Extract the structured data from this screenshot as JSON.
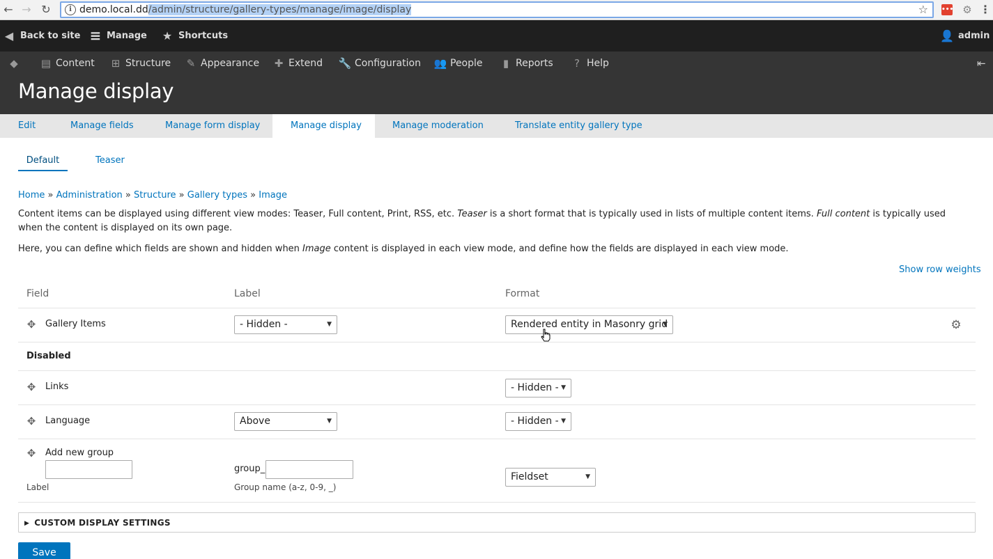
{
  "browser": {
    "url_host": "demo.local.dd",
    "url_path": "/admin/structure/gallery-types/manage/image/display",
    "ext_label": "•••"
  },
  "toolbar": {
    "back_to_site": "Back to site",
    "manage": "Manage",
    "shortcuts": "Shortcuts",
    "user": "admin"
  },
  "admin_menu": {
    "items": [
      "Content",
      "Structure",
      "Appearance",
      "Extend",
      "Configuration",
      "People",
      "Reports",
      "Help"
    ]
  },
  "page": {
    "title": "Manage display"
  },
  "primary_tabs": [
    "Edit",
    "Manage fields",
    "Manage form display",
    "Manage display",
    "Manage moderation",
    "Translate entity gallery type"
  ],
  "secondary_tabs": [
    "Default",
    "Teaser"
  ],
  "breadcrumb": [
    "Home",
    "Administration",
    "Structure",
    "Gallery types",
    "Image"
  ],
  "breadcrumb_sep": "»",
  "description": {
    "p1_a": "Content items can be displayed using different view modes: Teaser, Full content, Print, RSS, etc. ",
    "p1_em1": "Teaser",
    "p1_b": " is a short format that is typically used in lists of multiple content items. ",
    "p1_em2": "Full content",
    "p1_c": " is typically used when the content is displayed on its own page.",
    "p2_a": "Here, you can define which fields are shown and hidden when ",
    "p2_em": "Image",
    "p2_b": " content is displayed in each view mode, and define how the fields are displayed in each view mode."
  },
  "show_row_weights": "Show row weights",
  "table": {
    "headers": {
      "field": "Field",
      "label": "Label",
      "format": "Format"
    },
    "rows": [
      {
        "field": "Gallery Items",
        "label": "- Hidden -",
        "format": "Rendered entity in Masonry grid"
      },
      {
        "field": "Links",
        "label": "",
        "format": "- Hidden -"
      },
      {
        "field": "Language",
        "label": "Above",
        "format": "- Hidden -"
      }
    ],
    "disabled_label": "Disabled",
    "add_group": {
      "title": "Add new group",
      "label_caption": "Label",
      "prefix": "group_",
      "name_caption": "Group name (a-z, 0-9, _)",
      "format": "Fieldset"
    }
  },
  "custom_display_settings": "CUSTOM DISPLAY SETTINGS",
  "save_label": "Save",
  "colors": {
    "link": "#0074bd",
    "toolbar": "#1f1f1f",
    "admin_bg": "#353535"
  }
}
